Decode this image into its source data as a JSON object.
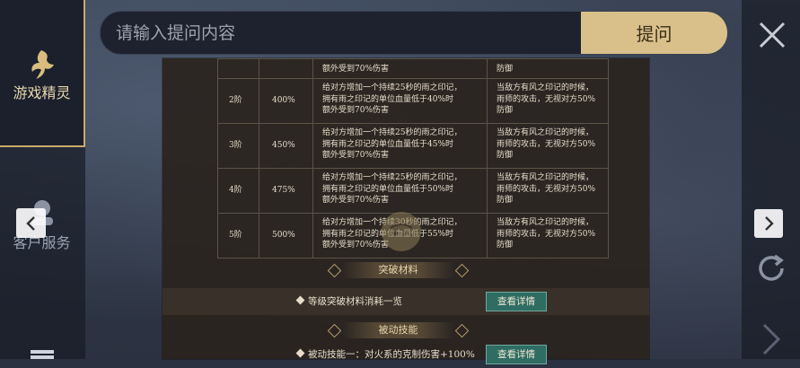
{
  "search": {
    "placeholder": "请输入提问内容",
    "button_label": "提问"
  },
  "sidebar": {
    "items": [
      {
        "label": "游戏精灵",
        "icon": "fairy-icon"
      },
      {
        "label": "客户服务",
        "icon": "headset-icon"
      }
    ]
  },
  "table": {
    "top_row": {
      "effect": "额外受到70%伤害",
      "bonus": "防御"
    },
    "rows": [
      {
        "level": "2阶",
        "percent": "400%",
        "effect": [
          "给对方增加一个持续25秒的雨之印记，",
          "拥有雨之印记的单位血量低于40%时",
          "额外受到70%伤害"
        ],
        "bonus": [
          "当敌方有风之印记的时候，",
          "雨师的攻击，无视对方50%",
          "防御"
        ]
      },
      {
        "level": "3阶",
        "percent": "450%",
        "effect": [
          "给对方增加一个持续25秒的雨之印记，",
          "拥有雨之印记的单位血量低于45%时",
          "额外受到70%伤害"
        ],
        "bonus": [
          "当敌方有风之印记的时候，",
          "雨师的攻击，无视对方50%",
          "防御"
        ]
      },
      {
        "level": "4阶",
        "percent": "475%",
        "effect": [
          "给对方增加一个持续25秒的雨之印记，",
          "拥有雨之印记的单位血量低于50%时",
          "额外受到70%伤害"
        ],
        "bonus": [
          "当敌方有风之印记的时候，",
          "雨师的攻击，无视对方50%",
          "防御"
        ]
      },
      {
        "level": "5阶",
        "percent": "500%",
        "effect": [
          "给对方增加一个持续30秒的雨之印记，",
          "拥有雨之印记的单位血量低于55%时",
          "额外受到70%伤害"
        ],
        "bonus": [
          "当敌方有风之印记的时候，",
          "雨师的攻击，无视对方50%",
          "防御"
        ]
      }
    ]
  },
  "sections": {
    "breakthrough_title": "突破材料",
    "breakthrough_item": "等级突破材料消耗一览",
    "passive_title": "被动技能",
    "passive_item": "被动技能一：对火系的克制伤害+100%",
    "detail_label": "查看详情"
  },
  "colors": {
    "accent": "#d9c08b",
    "detail_button": "#2f6d63"
  }
}
